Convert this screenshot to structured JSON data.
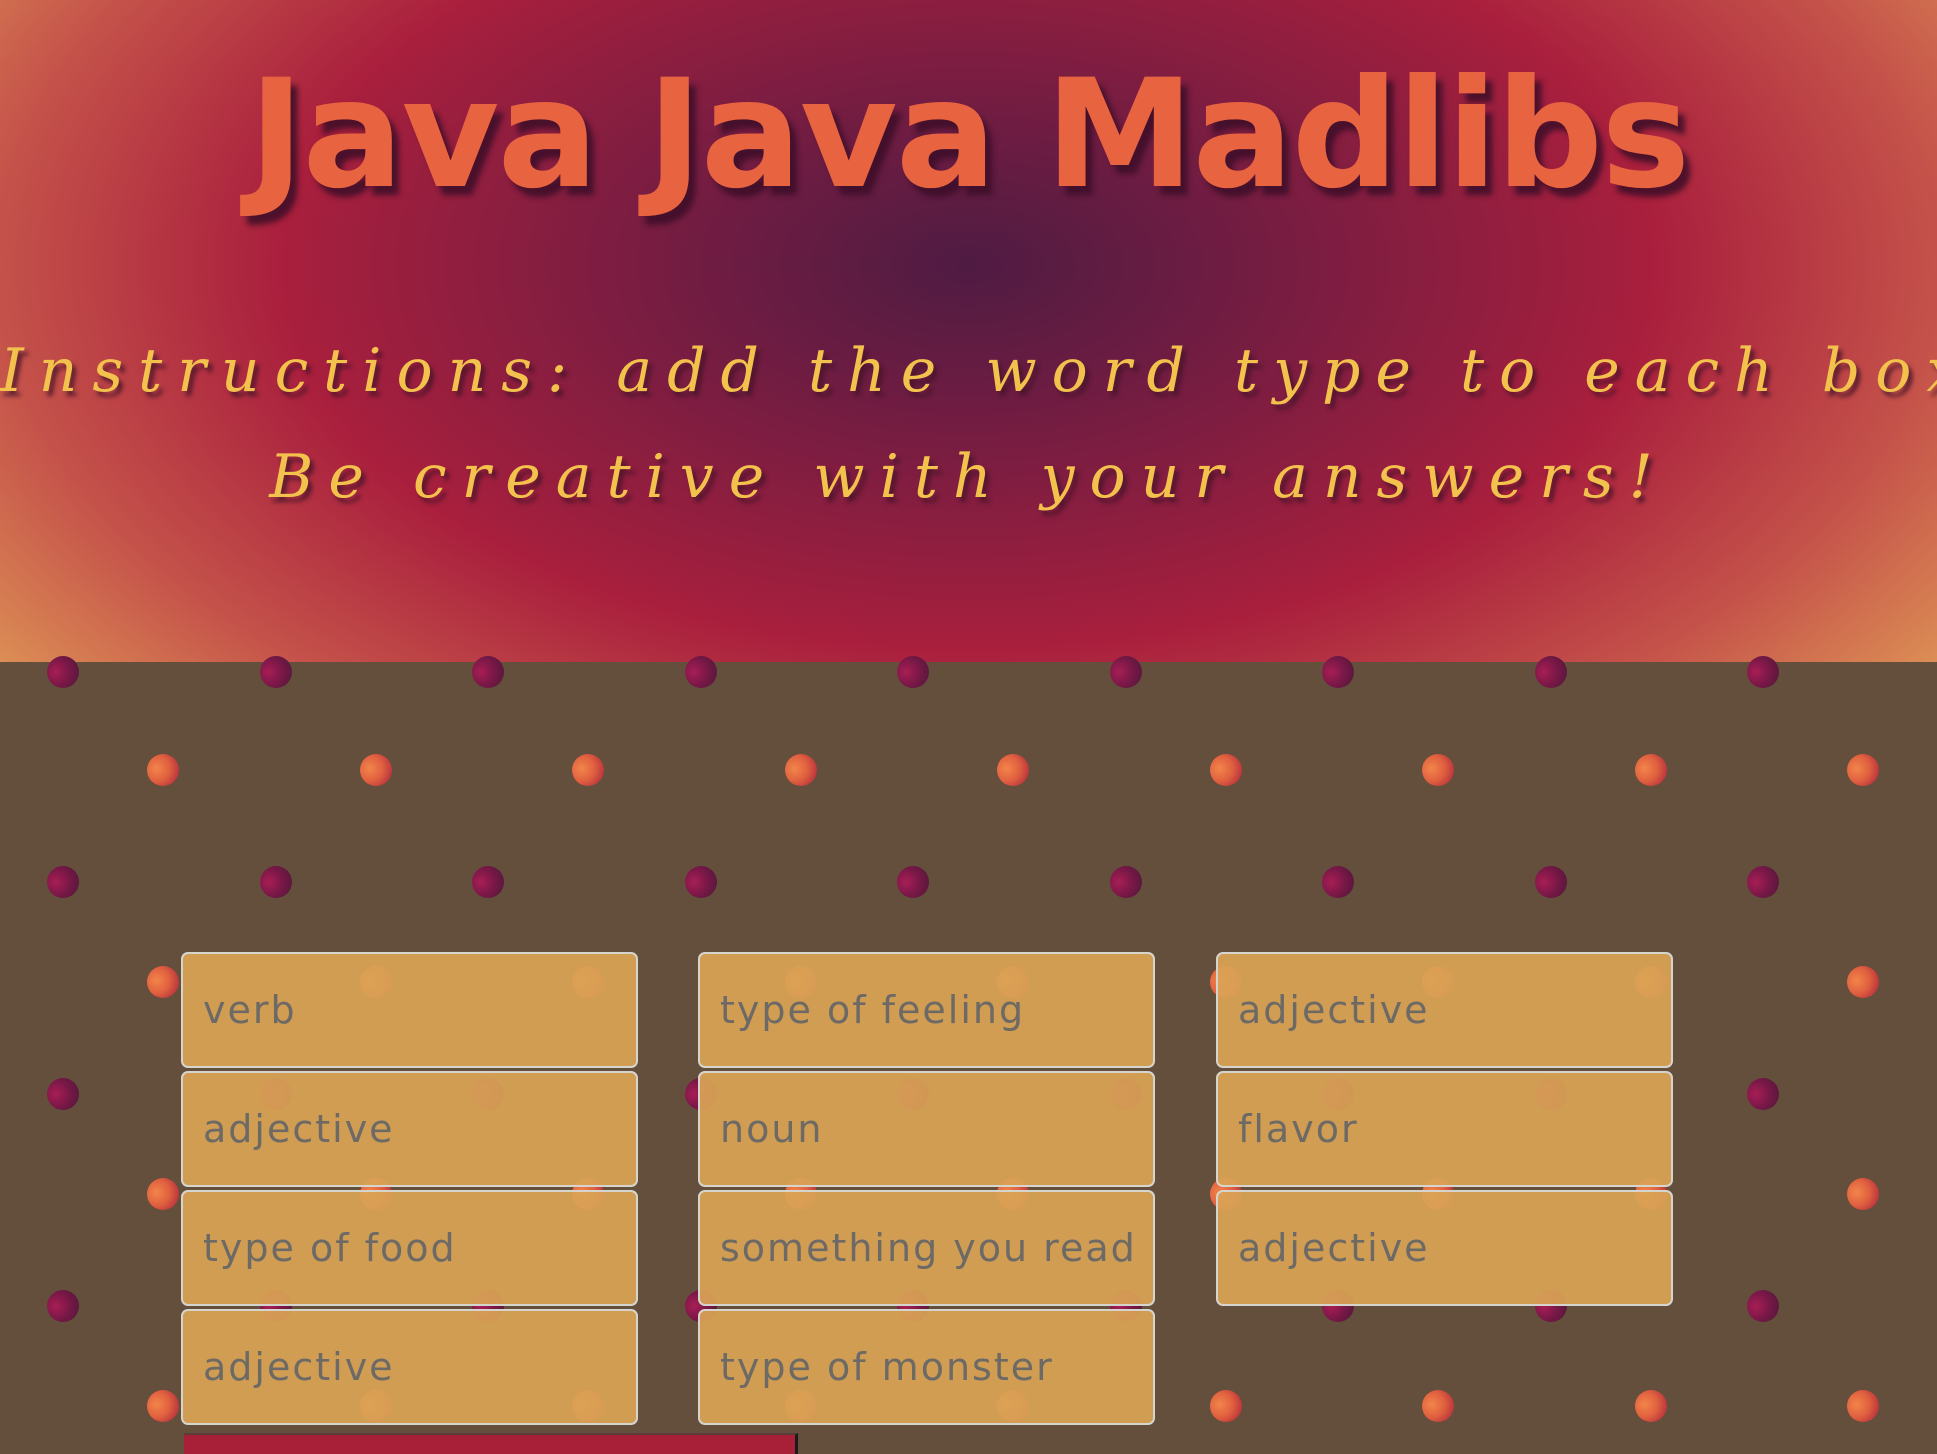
{
  "header": {
    "title": "Java Java Madlibs",
    "instructions_line1": "Instructions: add the word type to each box.",
    "instructions_line2": "Be creative with your answers!"
  },
  "colors": {
    "title": "#e8633f",
    "instructions": "#f2c24d",
    "background": "#644e3c",
    "field": "#daa456",
    "field_text": "#6d6a66",
    "submit": "#a72038"
  },
  "fields": {
    "col1": [
      "verb",
      "adjective",
      "type of food",
      "adjective"
    ],
    "col2": [
      "type of feeling",
      "noun",
      "something you read",
      "type of monster"
    ],
    "col3": [
      "adjective",
      "flavor",
      "adjective"
    ]
  }
}
